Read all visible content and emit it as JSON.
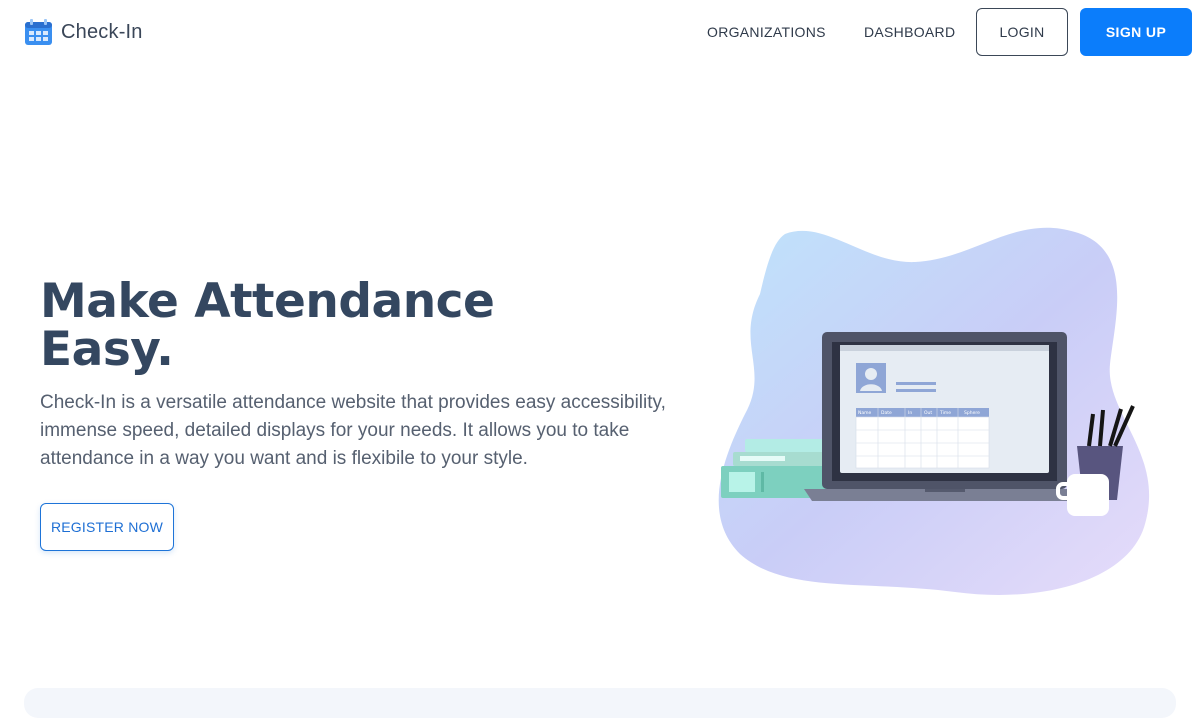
{
  "brand": {
    "name": "Check-In",
    "icon": "calendar-icon"
  },
  "nav": {
    "organizations": "ORGANIZATIONS",
    "dashboard": "DASHBOARD",
    "login": "LOGIN",
    "signup": "SIGN UP"
  },
  "hero": {
    "title_line1": "Make Attendance",
    "title_line2": "Easy.",
    "description": "Check-In is a versatile attendance website that provides easy accessibility, immense speed, detailed displays for your needs. It allows you to take attendance in a way you want and is flexibile to your style.",
    "cta": "REGISTER NOW"
  },
  "illustration": {
    "table_headers": [
      "Name",
      "Date",
      "In",
      "Out",
      "Time",
      "Sphere"
    ]
  },
  "colors": {
    "primary": "#0b7dfb",
    "title": "#344760",
    "text": "#566070"
  }
}
